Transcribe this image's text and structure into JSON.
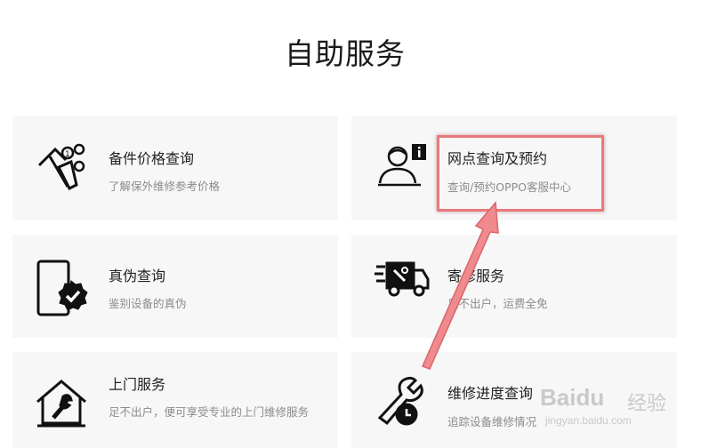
{
  "page": {
    "title": "自助服务"
  },
  "cards": [
    {
      "title": "备件价格查询",
      "desc": "了解保外维修参考价格",
      "icon": "parts-price-icon"
    },
    {
      "title": "网点查询及预约",
      "desc": "查询/预约OPPO客服中心",
      "icon": "service-center-icon"
    },
    {
      "title": "真伪查询",
      "desc": "鉴别设备的真伪",
      "icon": "authenticity-icon"
    },
    {
      "title": "寄修服务",
      "desc": "足不出户，运费全免",
      "icon": "mail-repair-icon"
    },
    {
      "title": "上门服务",
      "desc": "足不出户，便可享受专业的上门维修服务",
      "icon": "home-service-icon"
    },
    {
      "title": "维修进度查询",
      "desc": "追踪设备维修情况",
      "icon": "repair-progress-icon"
    }
  ],
  "annotation": {
    "color": "#e8797c"
  },
  "watermark": {
    "brand": "Baidu",
    "text": "经验",
    "url": "jingyan.baidu.com"
  }
}
